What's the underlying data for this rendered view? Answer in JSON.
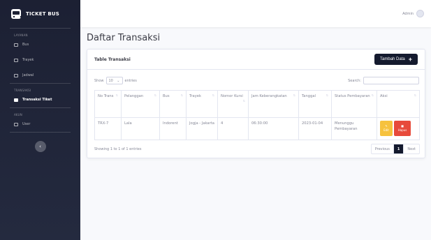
{
  "brand": {
    "title": "TICKET BUS"
  },
  "sidebar": {
    "headings": [
      "LAYANAN",
      "TRANSAKSI",
      "AKUN"
    ],
    "items": [
      {
        "label": "Bus",
        "icon": "bus-icon"
      },
      {
        "label": "Trayek",
        "icon": "route-icon"
      },
      {
        "label": "Jadwal",
        "icon": "calendar-icon"
      },
      {
        "label": "Transaksi Tiket",
        "icon": "receipt-icon"
      },
      {
        "label": "User",
        "icon": "user-icon"
      }
    ],
    "toggle": "‹"
  },
  "topbar": {
    "user": "Admin"
  },
  "page": {
    "title": "Daftar Transaksi"
  },
  "card": {
    "title": "Table Transaksi",
    "add_button": "Tambah Data",
    "add_symbol": "+",
    "show_prefix": "Show",
    "show_value": "10",
    "show_suffix": "entries",
    "search_label": "Search:",
    "columns": [
      "No Trans",
      "Pelanggan",
      "Bus",
      "Trayek",
      "Nomor Kursi",
      "Jam Keberangkatan",
      "Tanggal",
      "Status Pembayaran",
      "Aksi"
    ],
    "rows": [
      [
        "TRX-7",
        "Lala",
        "Indorent",
        "Jogja - Jakarta",
        "4",
        "06:30:00",
        "2023-01-04",
        "Menunggu Pembayaran"
      ]
    ],
    "actions": {
      "edit": "Edit",
      "delete": "Hapus"
    },
    "info": "Showing 1 to 1 of 1 entries",
    "pagination": {
      "previous": "Previous",
      "current": "1",
      "next": "Next"
    }
  },
  "colors": {
    "sidebar": "#1c2033",
    "primary": "#141a2e",
    "warning": "#f6c23e",
    "danger": "#e74a3b"
  }
}
